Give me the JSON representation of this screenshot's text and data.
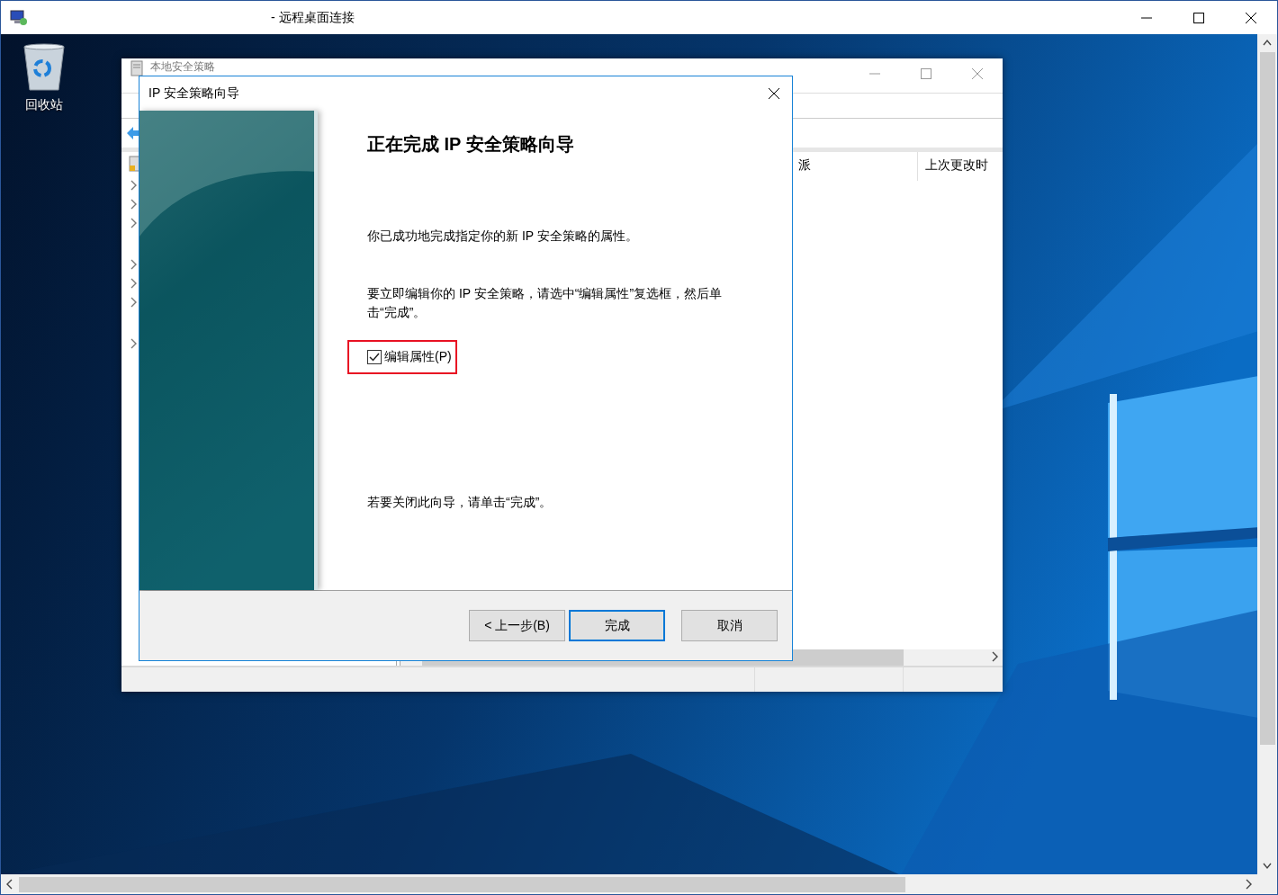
{
  "rdp_window": {
    "title": "- 远程桌面连接"
  },
  "desktop": {
    "icons": [
      {
        "label": "回收站"
      }
    ]
  },
  "background_window": {
    "title": "本地安全策略",
    "columns": [
      "派",
      "上次更改时"
    ]
  },
  "wizard": {
    "title": "IP 安全策略向导",
    "heading": "正在完成 IP 安全策略向导",
    "paragraphs": [
      "你已成功地完成指定你的新 IP 安全策略的属性。",
      "要立即编辑你的 IP 安全策略，请选中“编辑属性”复选框，然后单击“完成”。"
    ],
    "checkbox": {
      "label": "编辑属性(P)",
      "checked": true,
      "highlighted": true
    },
    "closing_text": "若要关闭此向导，请单击“完成”。",
    "buttons": [
      {
        "label": "< 上一步(B)",
        "default": false
      },
      {
        "label": "完成",
        "default": true
      },
      {
        "label": "取消",
        "default": false
      }
    ]
  }
}
